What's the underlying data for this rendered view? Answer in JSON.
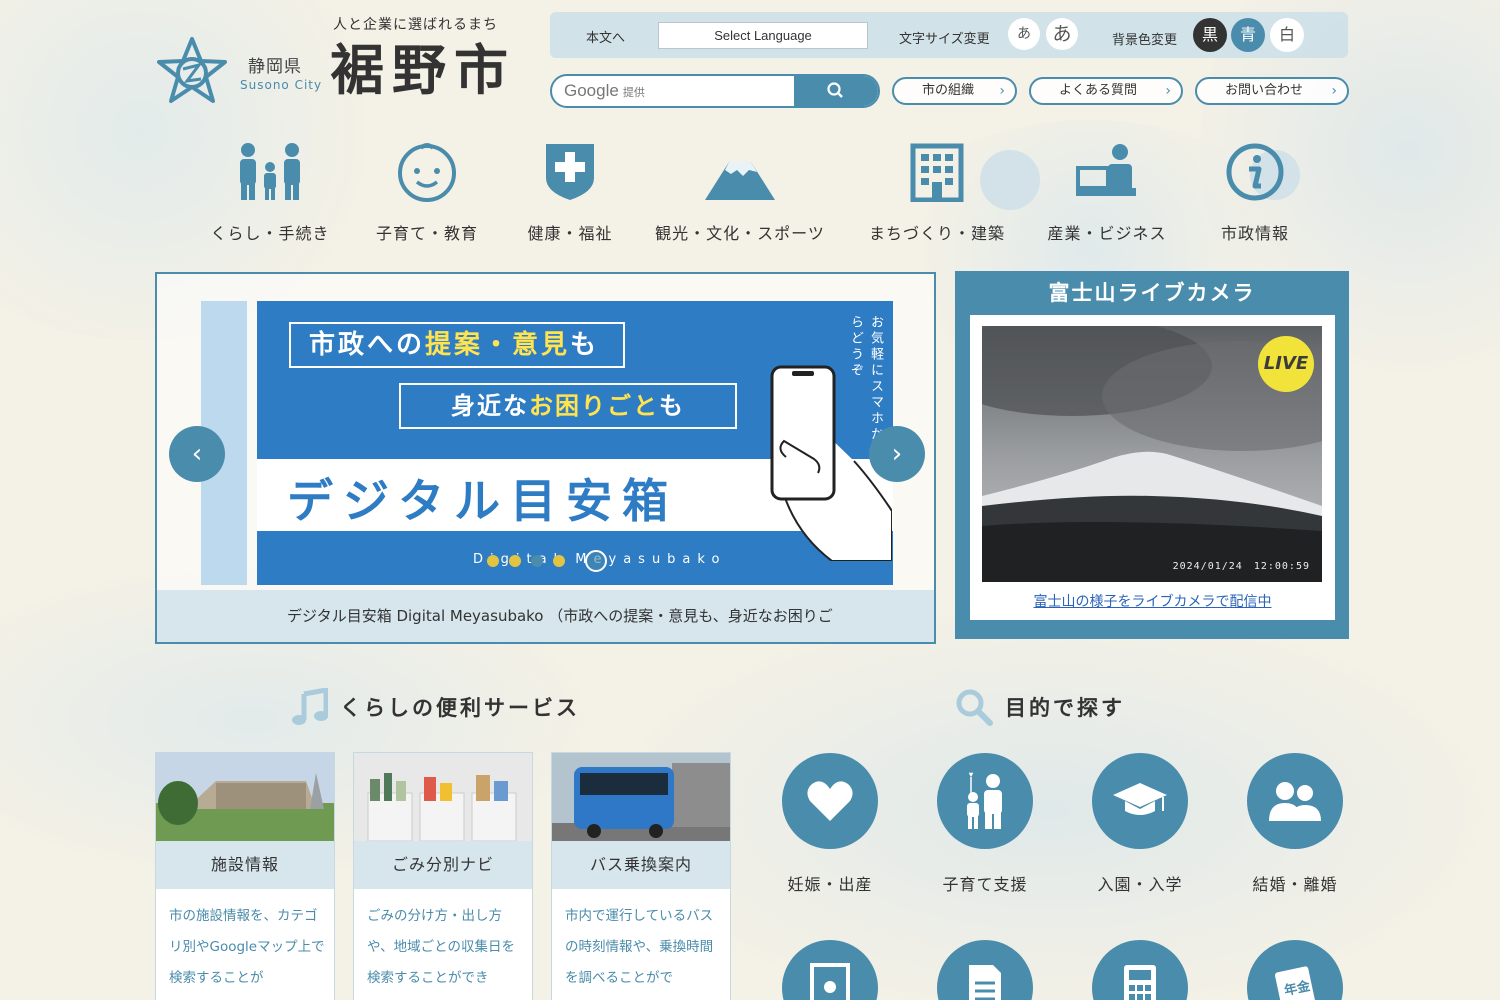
{
  "header": {
    "pref": "静岡県",
    "city_en": "Susono City",
    "tagline": "人と企業に選ばれるまち",
    "city_name": "裾野市"
  },
  "util": {
    "skip": "本文へ",
    "language": "Select Language",
    "font_size_label": "文字サイズ変更",
    "font_small": "あ",
    "font_large": "あ",
    "bg_color_label": "背景色変更",
    "bg_black": "黒",
    "bg_blue": "青",
    "bg_white": "白"
  },
  "search": {
    "google": "Google",
    "provided": "提供"
  },
  "quick_links": [
    "市の組織",
    "よくある質問",
    "お問い合わせ"
  ],
  "gnav": [
    {
      "label": "くらし・手続き",
      "icon": "family-icon"
    },
    {
      "label": "子育て・教育",
      "icon": "baby-face-icon"
    },
    {
      "label": "健康・福祉",
      "icon": "health-cross-icon"
    },
    {
      "label": "観光・文化・スポーツ",
      "icon": "mount-fuji-icon"
    },
    {
      "label": "まちづくり・建築",
      "icon": "building-icon"
    },
    {
      "label": "産業・ビジネス",
      "icon": "business-person-icon"
    },
    {
      "label": "市政情報",
      "icon": "info-icon"
    }
  ],
  "slider": {
    "line1_a": "市政への",
    "line1_hl": "提案・意見",
    "line1_b": "も",
    "line2_a": "身近な",
    "line2_hl": "お困りごと",
    "line2_b": "も",
    "title": "デジタル目安箱",
    "subtitle": "Digital Meyasubako",
    "vertical": "お気軽にスマホからどうぞ",
    "caption": "デジタル目安箱 Digital Meyasubako （市政への提案・意見も、身近なお困りご",
    "prev": "‹",
    "next": "›"
  },
  "livecam": {
    "title": "富士山ライブカメラ",
    "badge": "LIVE",
    "timestamp": "2024/01/24　12:00:59",
    "link": "富士山の様子をライブカメラで配信中"
  },
  "services": {
    "title": "くらしの便利サービス",
    "cards": [
      {
        "title": "施設情報",
        "desc": "市の施設情報を、カテゴリ別やGoogleマップ上で検索することが"
      },
      {
        "title": "ごみ分別ナビ",
        "desc": "ごみの分け方・出し方や、地域ごとの収集日を検索することができ"
      },
      {
        "title": "バス乗換案内",
        "desc": "市内で運行しているバスの時刻情報や、乗換時間を調べることがで"
      }
    ]
  },
  "purpose": {
    "title": "目的で探す",
    "items": [
      {
        "label": "妊娠・出産",
        "icon": "heart-icon"
      },
      {
        "label": "子育て支援",
        "icon": "parent-child-icon"
      },
      {
        "label": "入園・入学",
        "icon": "graduation-cap-icon"
      },
      {
        "label": "結婚・離婚",
        "icon": "couple-icon"
      }
    ],
    "row2_icons": [
      "id-card-icon",
      "document-icon",
      "calculator-icon",
      "pension-icon"
    ],
    "row2_pension_text": "年金"
  },
  "colors": {
    "accent": "#4a8cab",
    "slide_blue": "#2e7cc4",
    "highlight": "#ffe34f"
  }
}
